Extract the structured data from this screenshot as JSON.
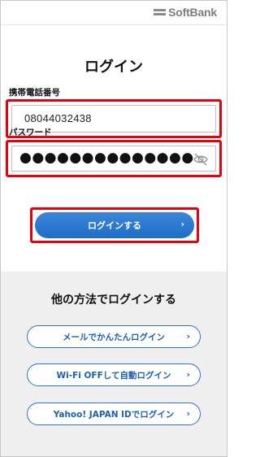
{
  "header": {
    "logo_text": "SoftBank"
  },
  "title": "ログイン",
  "phone": {
    "label": "携帯電話番号",
    "value": "08044032438"
  },
  "password": {
    "label": "パスワード",
    "masked_value": "●●●●●●●●●●●●●●",
    "toggle_icon": "eye-slash-icon"
  },
  "login_button": {
    "label": "ログインする",
    "chevron": "›"
  },
  "other_methods": {
    "title": "他の方法でログインする",
    "buttons": [
      {
        "label": "メールでかんたんログイン",
        "chevron": "›"
      },
      {
        "label": "Wi-Fi OFFして自動ログイン",
        "chevron": "›"
      },
      {
        "label": "Yahoo! JAPAN IDでログイン",
        "chevron": "›"
      }
    ]
  },
  "colors": {
    "highlight_red": "#e8000d",
    "primary_blue": "#2f73c9",
    "gray_bg": "#efefef"
  }
}
